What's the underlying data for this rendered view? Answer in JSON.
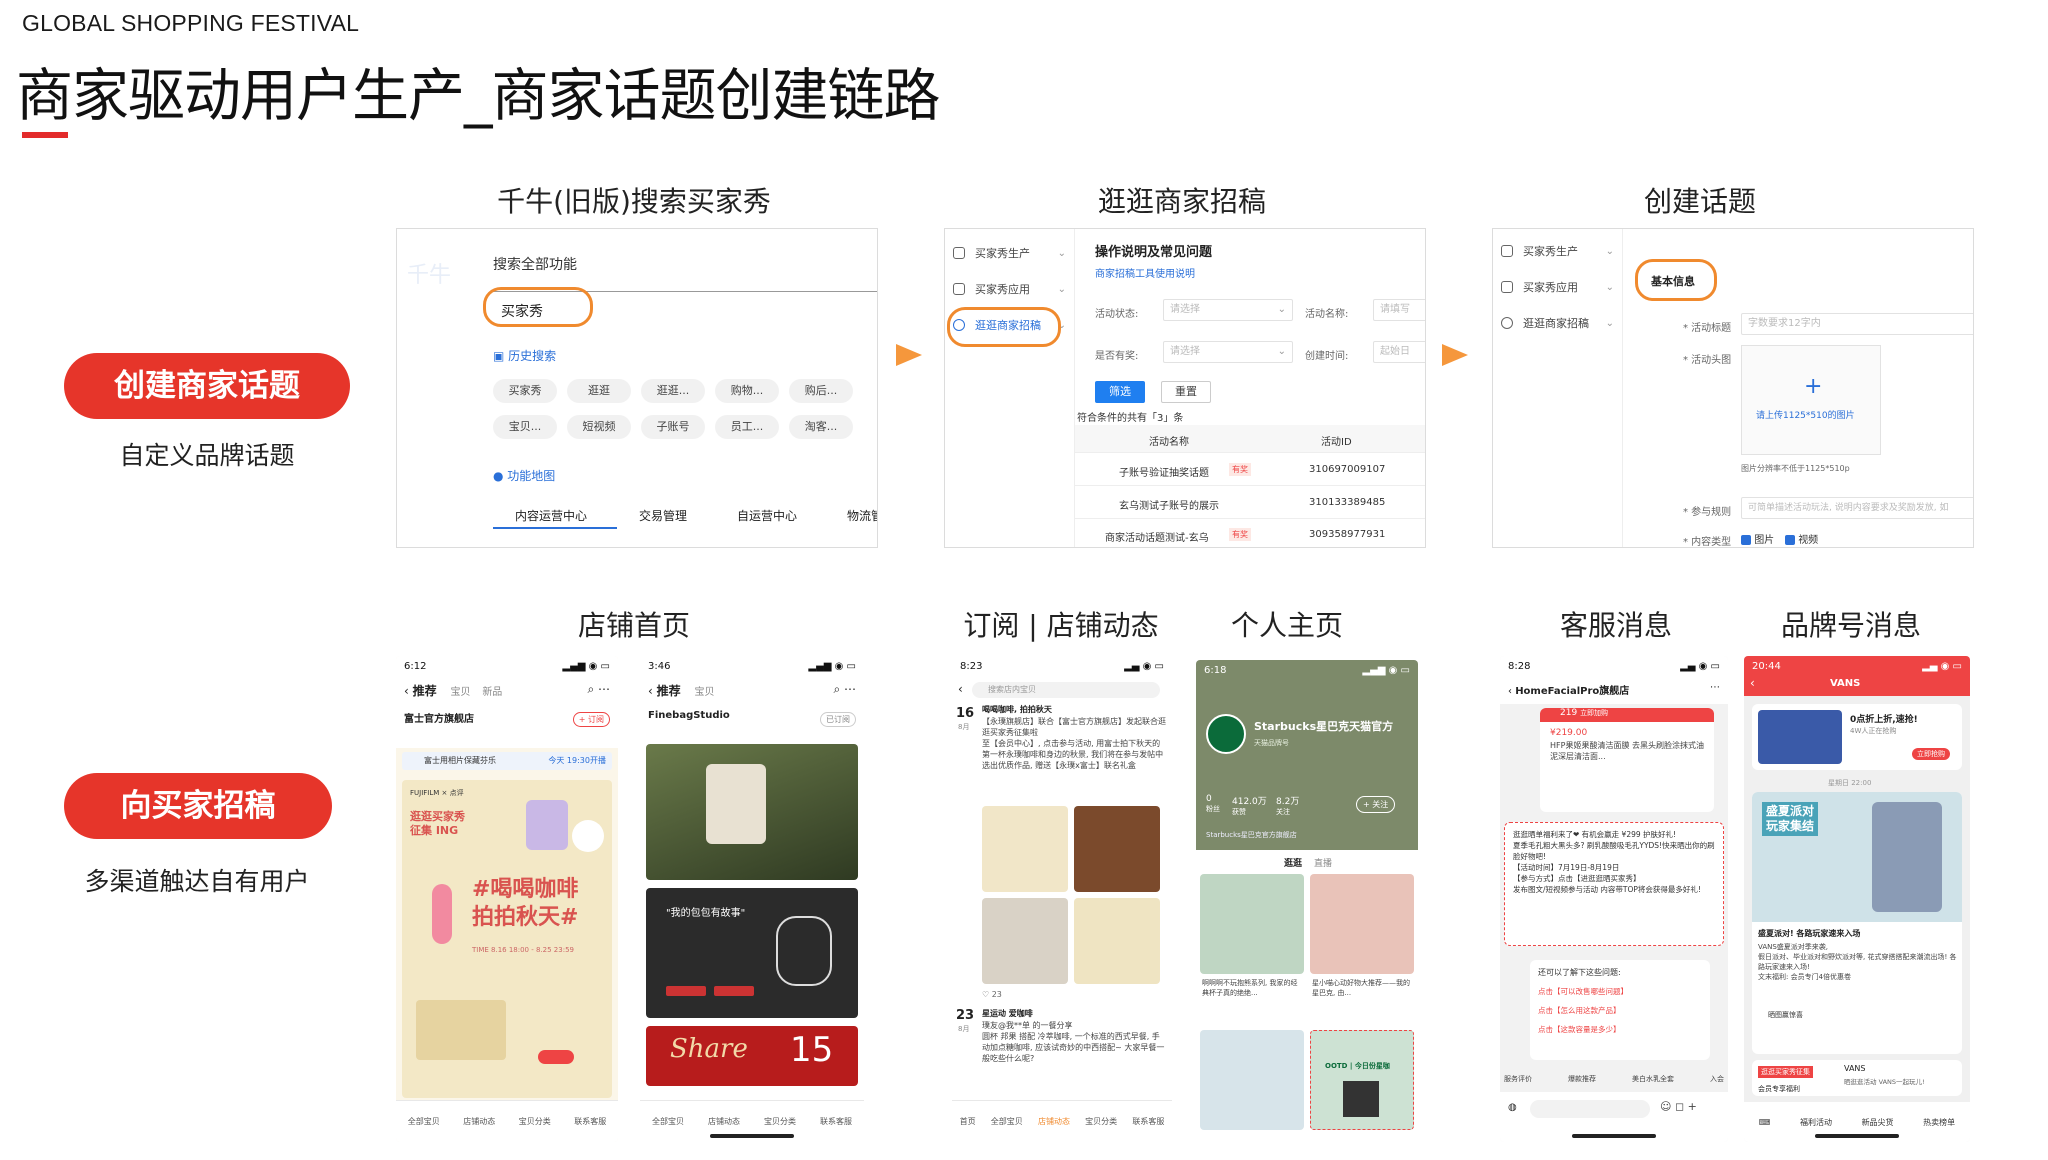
{
  "header": {
    "kicker": "GLOBAL SHOPPING FESTIVAL",
    "title": "商家驱动用户生产_商家话题创建链路"
  },
  "left": {
    "pill1": "创建商家话题",
    "sub1": "自定义品牌话题",
    "pill2": "向买家招稿",
    "sub2": "多渠道触达自有用户"
  },
  "sections": {
    "s1": "千牛(旧版)搜索买家秀",
    "s2": "逛逛商家招稿",
    "s3": "创建话题",
    "s4": "店铺首页",
    "s5": "订阅 | 店铺动态",
    "s6": "个人主页",
    "s7": "客服消息",
    "s8": "品牌号消息"
  },
  "shot1": {
    "watermark": "千牛",
    "search_label": "搜索全部功能",
    "search_value": "买家秀",
    "history": "历史搜索",
    "tags_row1": [
      "买家秀",
      "逛逛",
      "逛逛...",
      "购物...",
      "购后..."
    ],
    "tags_row2": [
      "宝贝...",
      "短视频",
      "子账号",
      "员工...",
      "淘客..."
    ],
    "map": "功能地图",
    "tabs": [
      "内容运营中心",
      "交易管理",
      "自运营中心",
      "物流管"
    ]
  },
  "shot2": {
    "menu": [
      "买家秀生产",
      "买家秀应用",
      "逛逛商家招稿"
    ],
    "heading": "操作说明及常见问题",
    "link": "商家招稿工具使用说明",
    "status_label": "活动状态:",
    "name_label": "活动名称:",
    "reward_label": "是否有奖:",
    "time_label": "创建时间:",
    "select_ph": "请选择",
    "input_ph": "请填写",
    "range_ph": "起始日",
    "btn_filter": "筛选",
    "btn_reset": "重置",
    "count_text": "符合条件的共有「3」条",
    "col_name": "活动名称",
    "col_id": "活动ID",
    "badge": "有奖",
    "rows": [
      {
        "name": "子账号验证抽奖话题",
        "id": "310697009107"
      },
      {
        "name": "玄乌测试子账号的展示",
        "id": "310133389485"
      },
      {
        "name": "商家活动话题测试-玄乌",
        "id": "309358977931"
      }
    ]
  },
  "shot3": {
    "menu": [
      "买家秀生产",
      "买家秀应用",
      "逛逛商家招稿"
    ],
    "basic": "基本信息",
    "title_label": "* 活动标题",
    "title_ph": "字数要求12字内",
    "head_label": "* 活动头图",
    "upload_hint": "请上传1125*510的图片",
    "size_hint": "图片分辨率不低于1125*510p",
    "rule_label": "* 参与规则",
    "rule_ph": "可简单描述活动玩法, 说明内容要求及奖励发放, 如",
    "type_label": "* 内容类型",
    "type_opts": [
      "图片",
      "视频"
    ]
  },
  "phone1": {
    "time": "6:12",
    "tabs": [
      "推荐",
      "宝贝",
      "新品"
    ],
    "store": "富士官方旗舰店",
    "follow": "+ 订阅",
    "notice": "富士用相片保藏芬乐",
    "notice_time": "今天 19:30开播",
    "poster_top": "FUJIFILM × 点评",
    "poster_tag": "逛逛买家秀\n征集 ING",
    "poster_big": "#喝喝咖啡\n拍拍秋天#",
    "poster_time": "TIME 8.16 18:00 - 8.25 23:59",
    "tabbar": [
      "全部宝贝",
      "店铺动态",
      "宝贝分类",
      "联系客服"
    ]
  },
  "phone2": {
    "time": "3:46",
    "tabs": [
      "推荐",
      "宝贝"
    ],
    "store": "FinebagStudio",
    "follow": "已订阅",
    "card_title": "\"我的包包有故事\"",
    "share": "Share",
    "share_num": "15",
    "tabbar": [
      "全部宝贝",
      "店铺动态",
      "宝贝分类",
      "联系客服"
    ]
  },
  "phone3": {
    "time": "8:23",
    "search": "搜索店内宝贝",
    "day1": "16",
    "mon1": "8月",
    "post1_title": "喝喝咖啡, 拍拍秋天",
    "post1_body": "【永璞旗舰店】联合【富士官方旗舰店】发起联合逛逛买家秀征集啦\n至【会员中心】, 点击参与活动, 用富士拍下秋天的第一杯永璞咖啡和身边的秋景, 我们将在参与发帖中选出优质作品, 赠送【永璞x富士】联名礼盒",
    "likes": "23",
    "day2": "23",
    "mon2": "8月",
    "post2_title": "星运动 爱咖啡",
    "post2_body": "璞友@我**单 的一餐分享\n圆杯 邦果 搭配 冷萃咖啡, 一个标准的西式早餐, 手动加点糖咖啡, 应该试奇妙的中西搭配~ 大家早餐一般吃些什么呢?",
    "tabbar": [
      "首页",
      "全部宝贝",
      "店铺动态",
      "宝贝分类",
      "联系客服"
    ]
  },
  "phone4": {
    "time": "6:18",
    "brand": "Starbucks星巴克天猫官方",
    "brand_sub": "天猫品牌号",
    "stats": [
      {
        "n": "0",
        "l": "粉丝"
      },
      {
        "n": "412.0万",
        "l": "获赞"
      },
      {
        "n": "8.2万",
        "l": "关注"
      }
    ],
    "follow": "+ 关注",
    "store_link": "Starbucks星巴克官方旗舰店",
    "tabs": [
      "逛逛",
      "直播"
    ],
    "item1": "啊啊啊不玩抱熊系列, 我家的经典杯子真的绝绝...",
    "item2": "星小喵心动好物大推荐——我的星巴克, 由...",
    "ootd": "OOTD | 今日份星咖"
  },
  "phone5": {
    "time": "8:28",
    "shop": "HomeFacialPro旗舰店",
    "price_tag": "219",
    "price_sub": "立即加购",
    "price": "¥219.00",
    "product": "HFP果姬果酸清洁面膜 去黑头刷脸涂抹式油泥深层清洁面...",
    "msg1": "逛逛晒单福利来了❤ 有机会赢走 ¥299 护肤好礼!\n夏季毛孔粗大黑头多? 刷乳酸酸吸毛孔YYDS!快来晒出你的刷脸好物吧!\n【活动时间】7月19日-8月19日\n【参与方式】点击【进逛逛晒买家秀】\n发布图文/短视频参与活动 内容带TOP将会获得最多好礼!",
    "msg2_head": "还可以了解下这些问题:",
    "faq": [
      "点击【可以改售哪些问题】",
      "点击【怎么用这款产品】",
      "点击【这款容量是多少】"
    ],
    "bottom": [
      "服务评价",
      "爆款推荐",
      "美白水乳全套",
      "入会"
    ]
  },
  "phone6": {
    "time": "20:44",
    "brand": "VANS",
    "promo": "0点折上折,速抢!",
    "promo_sub": "4W人正在抢购",
    "promo_btn": "立即抢购",
    "date": "星期日 22:00",
    "poster": "盛夏派对\n玩家集结",
    "caption": "盛夏派对! 各路玩家速来入场",
    "body": "VANS盛夏派对季来袭,\n假日派对、毕业派对和野炊派对等, 花式穿搭搭配来潮流出场! 各路玩家速来入场!\n文末福利: 会员专门4倍优惠卷",
    "msg_row": "晒图赢惊喜",
    "badge_text": "逛逛买家秀征集",
    "vans_row": "VANS",
    "vans_sub": "晒逛逛活动 VANS一起玩儿!",
    "member": "会员专享福利",
    "bottom": [
      "福利活动",
      "新品尖货",
      "热卖榜单"
    ]
  },
  "colors": {
    "accent_red": "#e6352a",
    "orange_ring": "#f08a2e",
    "arrow": "#f5973c",
    "link_blue": "#1f7ff0"
  }
}
